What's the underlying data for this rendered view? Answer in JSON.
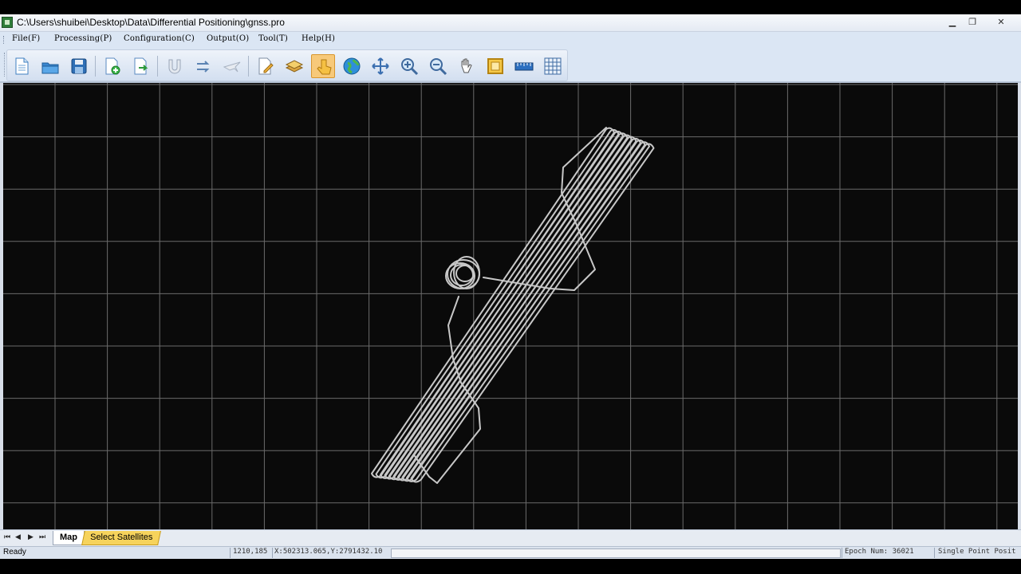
{
  "window": {
    "title": "C:\\Users\\shuibei\\Desktop\\Data\\Differential Positioning\\gnss.pro",
    "minimize_icon": "minimize-icon",
    "restore_icon": "restore-icon",
    "close_icon": "close-icon"
  },
  "menu": [
    {
      "label": "File(F)"
    },
    {
      "label": "Processing(P)"
    },
    {
      "label": "Configuration(C)"
    },
    {
      "label": "Output(O)"
    },
    {
      "label": "Tool(T)"
    },
    {
      "label": "Help(H)"
    }
  ],
  "toolbar": {
    "buttons": [
      {
        "icon": "new-document-icon",
        "active": false
      },
      {
        "icon": "open-folder-icon",
        "active": false
      },
      {
        "icon": "save-disk-icon",
        "active": false
      },
      {
        "icon": "add-file-icon",
        "active": false
      },
      {
        "icon": "export-file-icon",
        "active": false
      },
      {
        "icon": "magnet-icon",
        "active": false
      },
      {
        "icon": "process-arrows-icon",
        "active": false
      },
      {
        "icon": "airplane-icon",
        "active": false
      },
      {
        "icon": "edit-document-icon",
        "active": false
      },
      {
        "icon": "layers-icon",
        "active": false
      },
      {
        "icon": "pointer-hand-icon",
        "active": true
      },
      {
        "icon": "globe-icon",
        "active": false
      },
      {
        "icon": "pan-arrows-icon",
        "active": false
      },
      {
        "icon": "zoom-in-icon",
        "active": false
      },
      {
        "icon": "zoom-out-icon",
        "active": false
      },
      {
        "icon": "grab-hand-icon",
        "active": false
      },
      {
        "icon": "full-extent-icon",
        "active": false
      },
      {
        "icon": "measure-ruler-icon",
        "active": false
      },
      {
        "icon": "grid-icon",
        "active": false
      }
    ]
  },
  "map": {
    "background": "#0a0a0a",
    "grid_color": "#6b6b6b",
    "track_color": "#c8c8c8"
  },
  "tabs": {
    "nav_first": "⏮",
    "nav_prev": "◀",
    "nav_next": "▶",
    "nav_last": "⏭",
    "map_label": "Map",
    "satellites_label": "Select Satellites",
    "active": "Map"
  },
  "status": {
    "ready": "Ready",
    "screen_coords": "1210,185",
    "world_coords": "X:502313.065,Y:2791432.10",
    "epoch": "Epoch Num: 36021",
    "mode": "Single Point Posit"
  }
}
